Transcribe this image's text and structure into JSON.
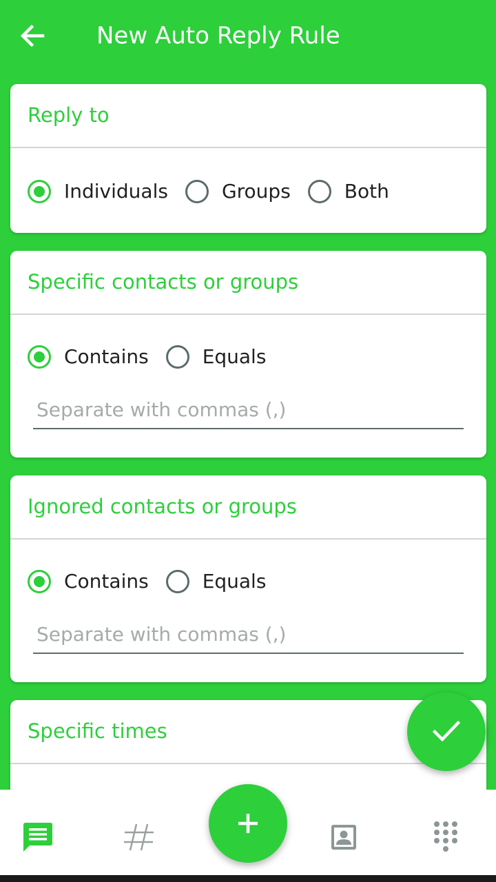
{
  "app_bar": {
    "title": "New Auto Reply Rule",
    "back_icon": "arrow-left-icon"
  },
  "colors": {
    "accent": "#2dcf3b",
    "radio_unchecked": "#5b6b6b",
    "placeholder": "#a5aaaa"
  },
  "reply_to": {
    "title": "Reply to",
    "options": [
      "Individuals",
      "Groups",
      "Both"
    ],
    "selected": "Individuals"
  },
  "specific_contacts": {
    "title": "Specific contacts or groups",
    "options": [
      "Contains",
      "Equals"
    ],
    "selected": "Contains",
    "input_placeholder": "Separate with commas (,)",
    "input_value": ""
  },
  "ignored_contacts": {
    "title": "Ignored contacts or groups",
    "options": [
      "Contains",
      "Equals"
    ],
    "selected": "Contains",
    "input_placeholder": "Separate with commas (,)",
    "input_value": ""
  },
  "specific_times": {
    "title": "Specific times"
  },
  "fab_save": {
    "icon": "checkmark-icon"
  },
  "fab_add": {
    "icon": "plus-icon"
  },
  "bottom_nav": {
    "items": [
      {
        "icon": "message-icon",
        "active": true
      },
      {
        "icon": "hashtag-icon",
        "active": false
      },
      {
        "icon": "contact-card-icon",
        "active": false
      },
      {
        "icon": "dialpad-icon",
        "active": false
      }
    ]
  }
}
